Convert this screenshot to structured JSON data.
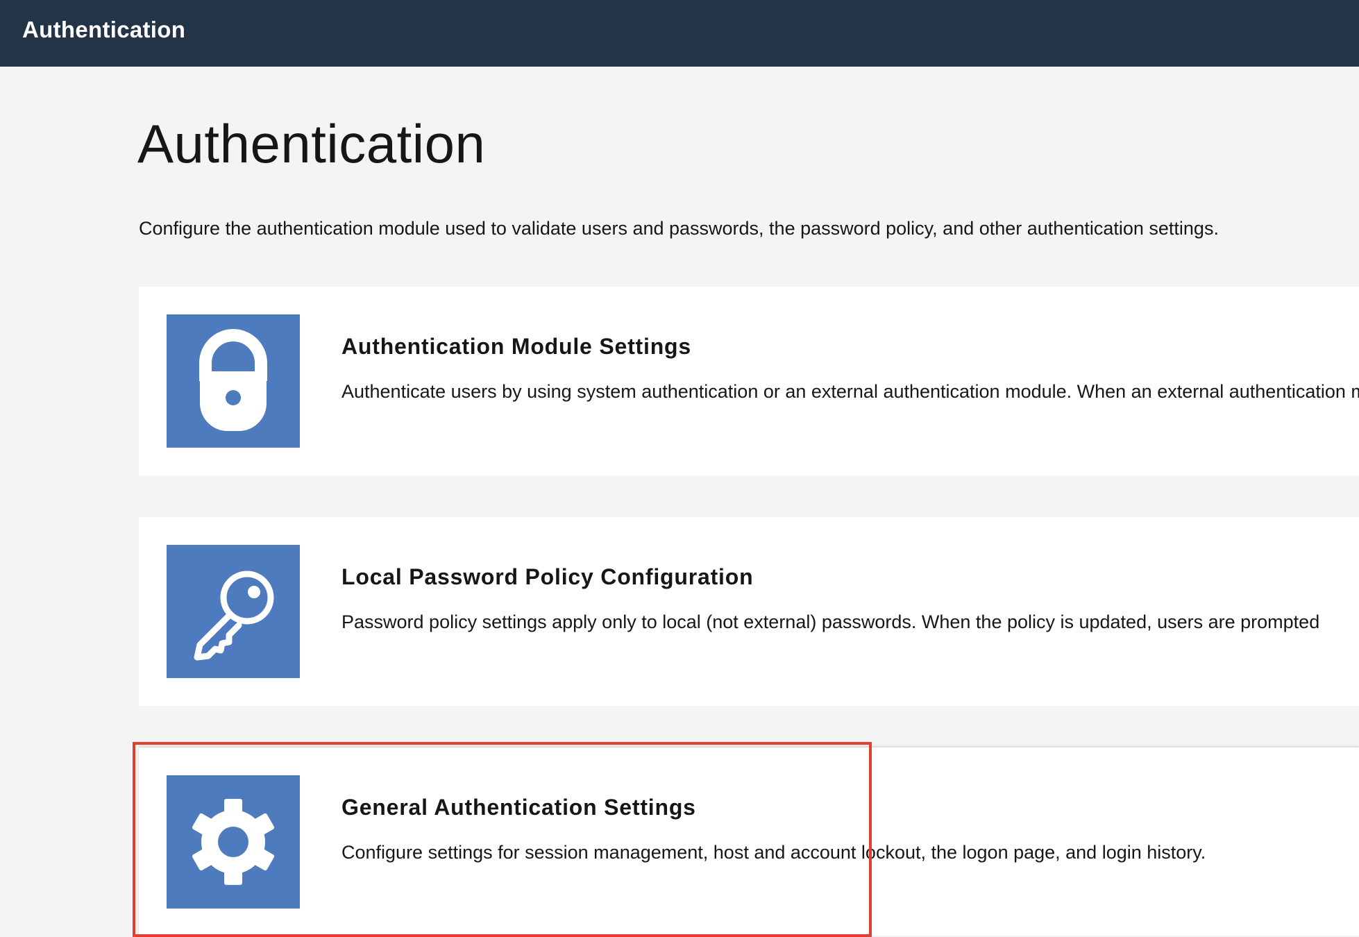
{
  "header": {
    "title": "Authentication"
  },
  "page": {
    "title": "Authentication",
    "description": "Configure the authentication module used to validate users and passwords, the password policy, and other authentication settings."
  },
  "cards": [
    {
      "title": "Authentication Module Settings",
      "description": "Authenticate users by using system authentication or an external authentication module. When an external authentication module is used",
      "icon": "lock-icon"
    },
    {
      "title": "Local Password Policy Configuration",
      "description": "Password policy settings apply only to local (not external) passwords. When the policy is updated, users are prompted",
      "icon": "key-icon"
    },
    {
      "title": "General Authentication Settings",
      "description": "Configure settings for session management, host and account lockout, the logon page, and login history.",
      "icon": "gear-icon"
    }
  ],
  "colors": {
    "header_bg": "#233447",
    "page_bg": "#f4f4f4",
    "icon_tile": "#4d7bbe",
    "highlight": "#e0402e"
  }
}
